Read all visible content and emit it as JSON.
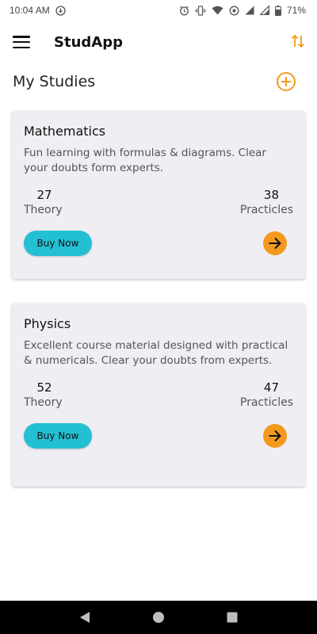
{
  "status_bar": {
    "time": "10:04 AM",
    "battery": "71%"
  },
  "app_bar": {
    "title": "StudApp"
  },
  "section": {
    "title": "My Studies"
  },
  "courses": [
    {
      "title": "Mathematics",
      "description": "Fun learning with formulas & diagrams. Clear your doubts form experts.",
      "theory_count": "27",
      "theory_label": "Theory",
      "practicles_count": "38",
      "practicles_label": "Practicles",
      "buy_label": "Buy Now"
    },
    {
      "title": "Physics",
      "description": "Excellent course material designed with practical & numericals. Clear your doubts from experts.",
      "theory_count": "52",
      "theory_label": "Theory",
      "practicles_count": "47",
      "practicles_label": "Practicles",
      "buy_label": "Buy Now"
    }
  ],
  "colors": {
    "accent": "#f39a1e",
    "buy_button": "#23c0d4",
    "card_bg": "#eeeef3"
  },
  "icons": {
    "menu": "hamburger-menu-icon",
    "sort": "sort-arrows-icon",
    "add": "add-circle-icon",
    "go": "arrow-right-icon",
    "nav_back": "back-triangle-icon",
    "nav_home": "home-circle-icon",
    "nav_recents": "recents-square-icon"
  }
}
